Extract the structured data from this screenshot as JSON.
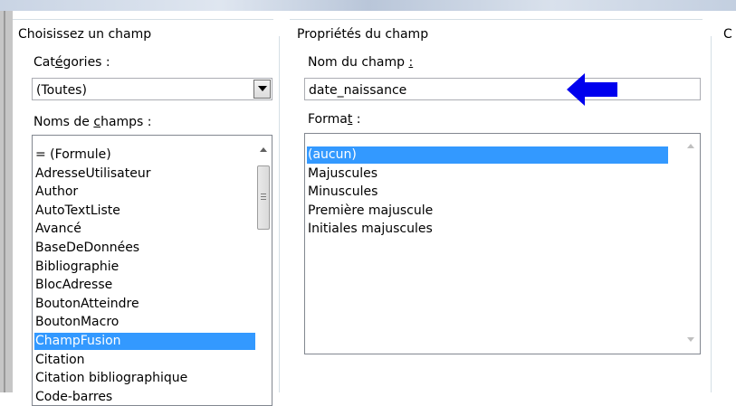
{
  "left_group": {
    "title": "Choisissez un champ",
    "categories_label": "Catégories :",
    "categories_value": "(Toutes)",
    "field_names_label": "Noms de champs :",
    "field_names": [
      "= (Formule)",
      "AdresseUtilisateur",
      "Author",
      "AutoTextListe",
      "Avancé",
      "BaseDeDonnées",
      "Bibliographie",
      "BlocAdresse",
      "BoutonAtteindre",
      "BoutonMacro",
      "ChampFusion",
      "Citation",
      "Citation bibliographique",
      "Code-barres"
    ],
    "selected_field": "ChampFusion"
  },
  "right_group": {
    "title": "Propriétés du champ",
    "field_name_label": "Nom du champ :",
    "field_name_value": "date_naissance",
    "format_label": "Format :",
    "formats": [
      "(aucun)",
      "Majuscules",
      "Minuscules",
      "Première majuscule",
      "Initiales majuscules"
    ],
    "selected_format": "(aucun)"
  },
  "third_group": {
    "title": "C"
  },
  "colors": {
    "selection": "#3399ff",
    "arrow": "#0000ee",
    "group_line": "#d5dfe5"
  },
  "icons": {
    "pointer_arrow": "left-arrow-icon"
  }
}
